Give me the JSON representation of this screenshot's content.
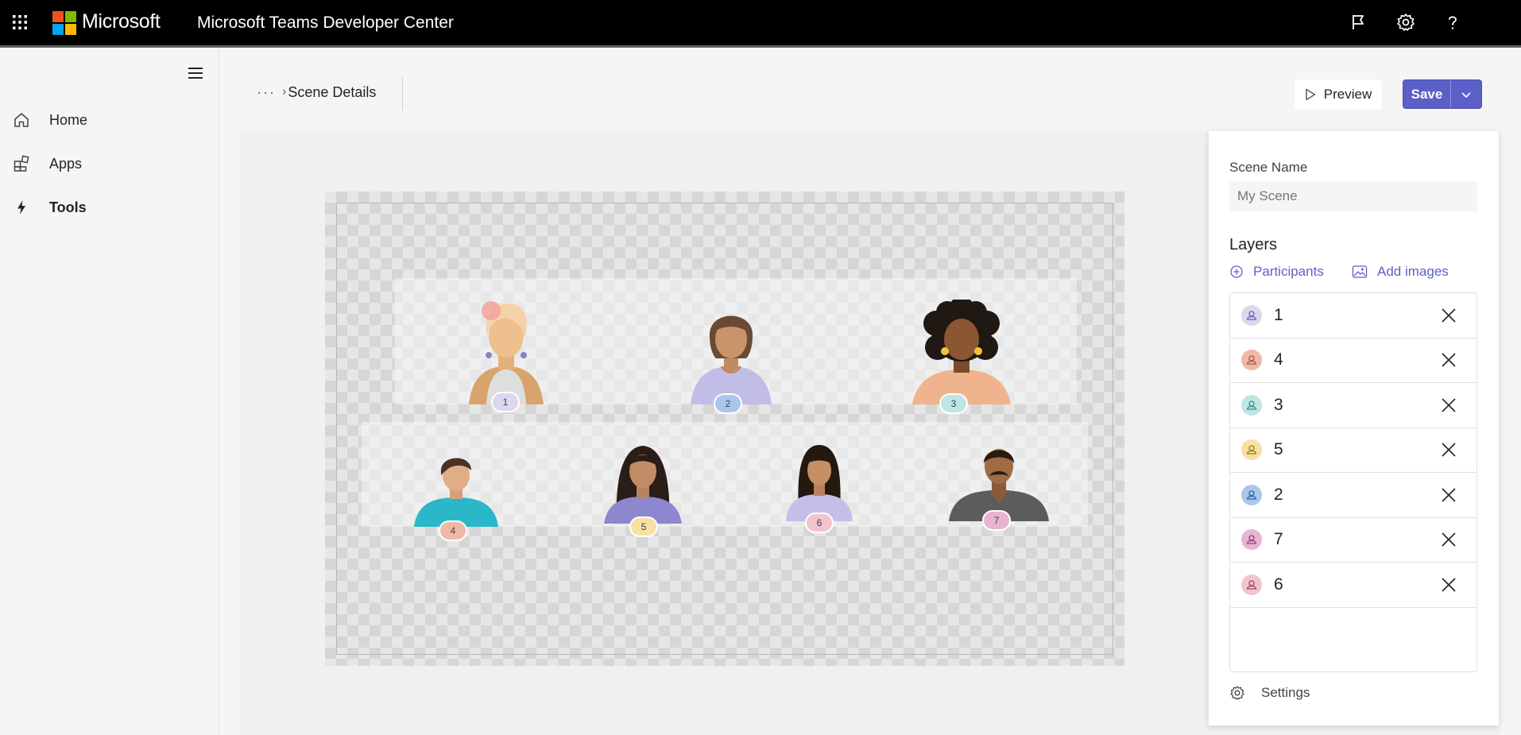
{
  "topbar": {
    "brand": "Microsoft",
    "product": "Microsoft Teams Developer Center",
    "icons": [
      "app-launcher-icon",
      "flag-icon",
      "gear-icon",
      "help-icon"
    ]
  },
  "nav": {
    "items": [
      {
        "label": "Home",
        "icon": "home-icon"
      },
      {
        "label": "Apps",
        "icon": "apps-icon"
      },
      {
        "label": "Tools",
        "icon": "lightning-icon",
        "active": true
      }
    ]
  },
  "breadcrumb": {
    "more": "···",
    "current": "Scene Details"
  },
  "actions": {
    "preview": "Preview",
    "save": "Save"
  },
  "scene": {
    "participants": [
      {
        "number": "1",
        "badge_color": "#dcd6ee"
      },
      {
        "number": "2",
        "badge_color": "#a9c7ec"
      },
      {
        "number": "3",
        "badge_color": "#bfe6e4"
      },
      {
        "number": "4",
        "badge_color": "#f0b8a6"
      },
      {
        "number": "5",
        "badge_color": "#f8e0a3"
      },
      {
        "number": "6",
        "badge_color": "#f1c4cc"
      },
      {
        "number": "7",
        "badge_color": "#e8b4d2"
      }
    ]
  },
  "panel": {
    "scene_name_label": "Scene Name",
    "scene_name_placeholder": "My Scene",
    "layers_label": "Layers",
    "add_participants": "Participants",
    "add_images": "Add images",
    "layers": [
      {
        "name": "1",
        "color": "#dcd6ee",
        "icon_color": "#6b5fa8"
      },
      {
        "name": "4",
        "color": "#f0b8a6",
        "icon_color": "#a8543d"
      },
      {
        "name": "3",
        "color": "#bfe6e4",
        "icon_color": "#3a8c88"
      },
      {
        "name": "5",
        "color": "#f8e0a3",
        "icon_color": "#9c7a1c"
      },
      {
        "name": "2",
        "color": "#a9c7ec",
        "icon_color": "#2f5f99"
      },
      {
        "name": "7",
        "color": "#e8b4d2",
        "icon_color": "#9a3f72"
      },
      {
        "name": "6",
        "color": "#f1c4cc",
        "icon_color": "#a34456"
      }
    ],
    "settings": "Settings"
  },
  "colors": {
    "accent": "#5b5fc7",
    "topbar": "#000000"
  }
}
